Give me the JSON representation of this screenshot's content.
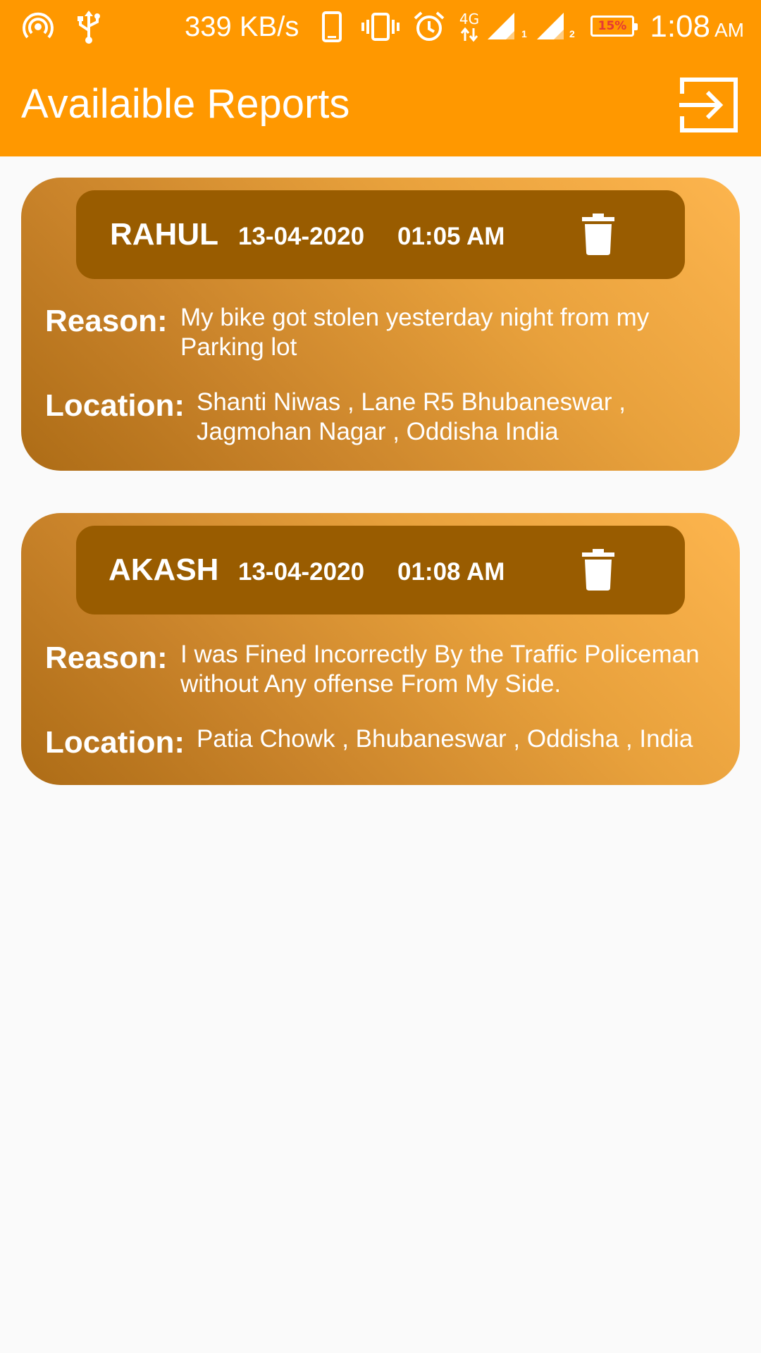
{
  "status_bar": {
    "network_speed": "339 KB/s",
    "network_type": "4G",
    "sim1_label": "1",
    "sim2_label": "2",
    "battery": "15%",
    "time": "1:08",
    "ampm": "AM",
    "icons": [
      "hotspot-icon",
      "usb-icon",
      "phone-icon",
      "vibrate-icon",
      "alarm-icon",
      "4g-icon",
      "signal-icon",
      "battery-icon"
    ]
  },
  "app_bar": {
    "title": "Availaible Reports",
    "action_icon": "logout-icon"
  },
  "colors": {
    "app_bar": "#ff9800",
    "card_header": "#995c00",
    "card_gradient_light": "#fdb54e",
    "card_gradient_dark": "#ad6c16",
    "background": "#fafafa"
  },
  "reports": [
    {
      "name": "RAHUL",
      "date": "13-04-2020",
      "time": "01:05 AM",
      "reason_label": "Reason:",
      "reason": "My bike got stolen yesterday night from my Parking lot",
      "location_label": "Location:",
      "location": "Shanti Niwas , Lane R5 Bhubaneswar , Jagmohan Nagar , Oddisha India"
    },
    {
      "name": "AKASH",
      "date": "13-04-2020",
      "time": "01:08 AM",
      "reason_label": "Reason:",
      "reason": "I was Fined Incorrectly By the Traffic Policeman without Any offense From My Side.",
      "location_label": "Location:",
      "location": "Patia Chowk , Bhubaneswar , Oddisha , India"
    }
  ]
}
